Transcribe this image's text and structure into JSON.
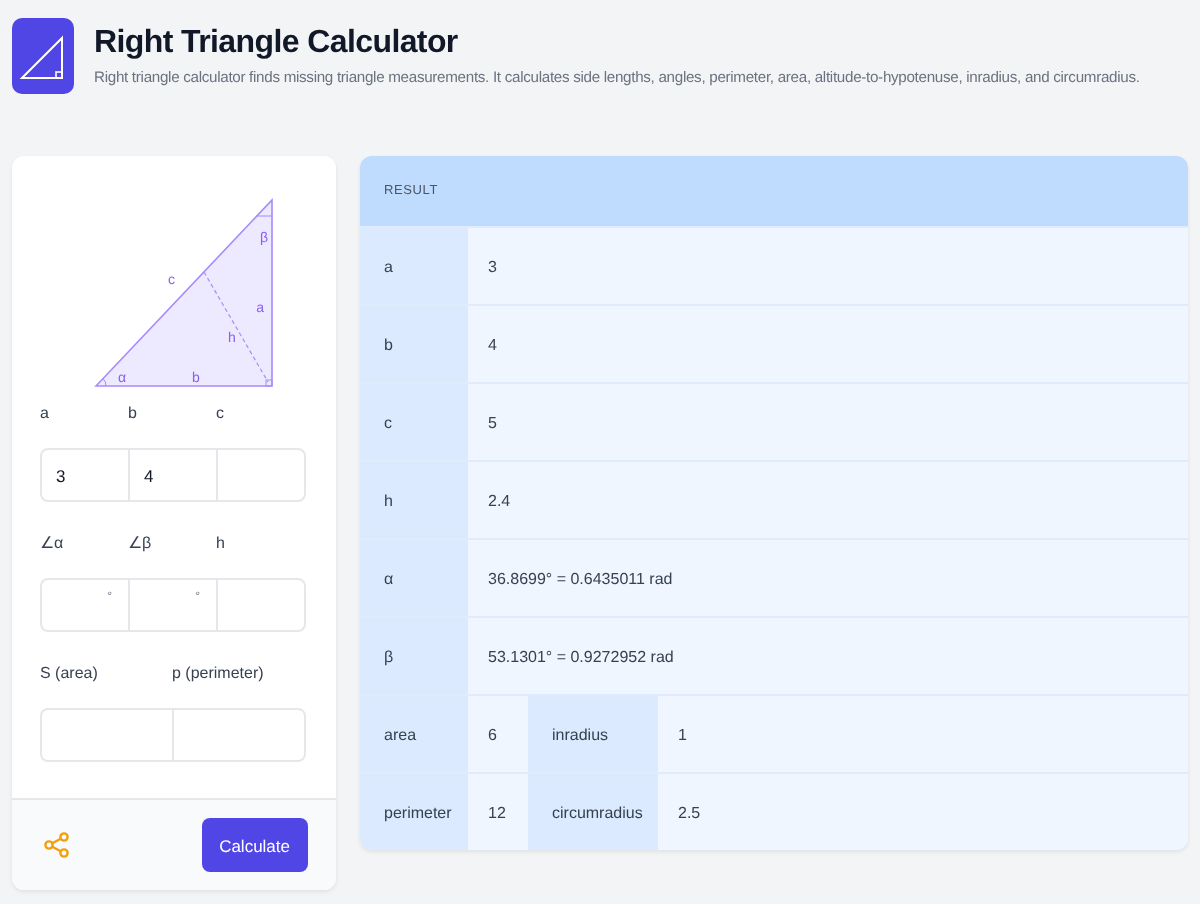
{
  "header": {
    "title": "Right Triangle Calculator",
    "description": "Right triangle calculator finds missing triangle measurements. It calculates side lengths, angles, perimeter, area, altitude-to-hypotenuse, inradius, and circumradius."
  },
  "diagram": {
    "beta": "β",
    "c": "c",
    "a": "a",
    "h": "h",
    "alpha": "α",
    "b": "b"
  },
  "form": {
    "groups": [
      {
        "fields": [
          {
            "label": "a",
            "value": "3"
          },
          {
            "label": "b",
            "value": "4"
          },
          {
            "label": "c"
          }
        ]
      },
      {
        "fields": [
          {
            "label": "∠α",
            "unit": "°"
          },
          {
            "label": "∠β",
            "unit": "°"
          },
          {
            "label": "h"
          }
        ]
      },
      {
        "fields": [
          {
            "label": "S (area)"
          },
          {
            "label": "p (perimeter)"
          }
        ]
      }
    ],
    "button": "Calculate"
  },
  "result": {
    "heading": "RESULT",
    "rows": [
      {
        "cells": [
          {
            "kind": "label",
            "text": "a"
          },
          {
            "kind": "value",
            "text": "3"
          }
        ]
      },
      {
        "cells": [
          {
            "kind": "label",
            "text": "b"
          },
          {
            "kind": "value",
            "text": "4"
          }
        ]
      },
      {
        "cells": [
          {
            "kind": "label",
            "text": "c"
          },
          {
            "kind": "value",
            "text": "5"
          }
        ]
      },
      {
        "cells": [
          {
            "kind": "label",
            "text": "h"
          },
          {
            "kind": "value",
            "text": "2.4"
          }
        ]
      },
      {
        "cells": [
          {
            "kind": "label",
            "text": "α"
          },
          {
            "kind": "value",
            "text": "36.8699° = 0.6435011 rad"
          }
        ]
      },
      {
        "cells": [
          {
            "kind": "label",
            "text": "β"
          },
          {
            "kind": "value",
            "text": "53.1301° = 0.9272952 rad"
          }
        ]
      },
      {
        "cells": [
          {
            "kind": "label",
            "text": "area"
          },
          {
            "kind": "value",
            "text": "6"
          },
          {
            "kind": "label",
            "text": "inradius"
          },
          {
            "kind": "value",
            "text": "1"
          }
        ]
      },
      {
        "cells": [
          {
            "kind": "label",
            "text": "perimeter"
          },
          {
            "kind": "value",
            "text": "12"
          },
          {
            "kind": "label",
            "text": "circumradius"
          },
          {
            "kind": "value",
            "text": "2.5"
          }
        ]
      }
    ]
  }
}
